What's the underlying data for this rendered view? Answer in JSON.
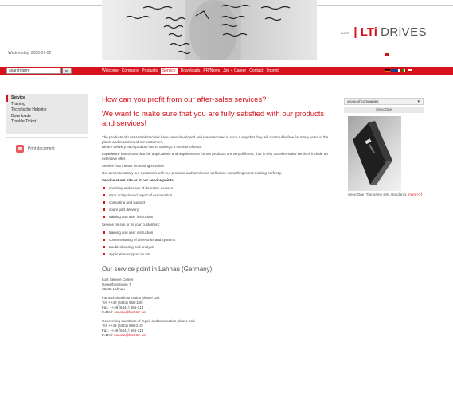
{
  "header": {
    "date": "Wednesday, 2008-07-02",
    "logo": {
      "small": "LUST",
      "lti": "LTi",
      "drives": "DRiVES"
    }
  },
  "search": {
    "value": "search term",
    "go": "go"
  },
  "nav": {
    "items": [
      {
        "label": "Welcome",
        "active": false
      },
      {
        "label": "Company",
        "active": false
      },
      {
        "label": "Products",
        "active": false
      },
      {
        "label": "Service",
        "active": true
      },
      {
        "label": "Downloads",
        "active": false
      },
      {
        "label": "PR/News",
        "active": false
      },
      {
        "label": "Job + Career",
        "active": false
      },
      {
        "label": "Contact",
        "active": false
      },
      {
        "label": "Imprint",
        "active": false
      }
    ]
  },
  "sidebar": {
    "items": [
      {
        "label": "Service",
        "active": true
      },
      {
        "label": "Training",
        "active": false
      },
      {
        "label": "Technische Helpline",
        "active": false
      },
      {
        "label": "Downloads",
        "active": false
      },
      {
        "label": "Trouble Ticket",
        "active": false
      }
    ],
    "print": "Print document"
  },
  "main": {
    "title": "How can you profit from our after-sales services?",
    "subtitle": "We want to make sure that you are fully satisfied with our products and services!",
    "p1": "The products of Lust Antriebstechnik have been developed and manufactured in such a way that they will run trouble-free for many years in the plants and machines of our customers.",
    "p2": "Before delivery each product has to undergo a number of tests.",
    "p3": "Experience has shown that the applications and requirements for our products are very different, that is why our after-sales services include an extensive offer.",
    "p4": "Service that means increasing in value!",
    "p5": "Our aim is to satisfy our customers with our products and service as well when something is not working perfectly.",
    "points_heading": "Service at our site or at our service points:",
    "points": [
      "checking and repair of defective devices",
      "error analysis and report of examination",
      "consulting and support",
      "spare part delivery",
      "training and user instruction"
    ],
    "onsite_heading": "Service on site or at your customers:",
    "onsite": [
      "training and user instruction",
      "commissioning of drive units and systems",
      "troubleshooting and analysis",
      "application support on site"
    ],
    "service_point_title": "Our service point in Lahnau (Germany):",
    "address": [
      "Lust Service Center",
      "Gewerbestrasse 7",
      "35633 Lahnau"
    ],
    "tech_info": {
      "heading": "For technical information please call:",
      "tel": "Tel. ++49 (6441) 966-180",
      "fax": "Fax. ++49 (6441) 966-211",
      "email_label": "E-Mail:",
      "email": "service@lust-tec.de"
    },
    "repair": {
      "heading": "Concerning questions of repair and transaction please call:",
      "tel": "Tel. ++49 (6441) 966-210",
      "fax": "Fax. ++49 (6441) 966-211",
      "email_label": "E-Mail:",
      "email": "service@lust-tec.de"
    }
  },
  "right": {
    "select": "group of companies",
    "product_title": "ServoOne",
    "caption": "ServoOne_The name sets standards",
    "more": "[more>>]"
  },
  "colors": {
    "brand_red": "#d6121c",
    "sidebar_bg": "#e8e8e8"
  }
}
